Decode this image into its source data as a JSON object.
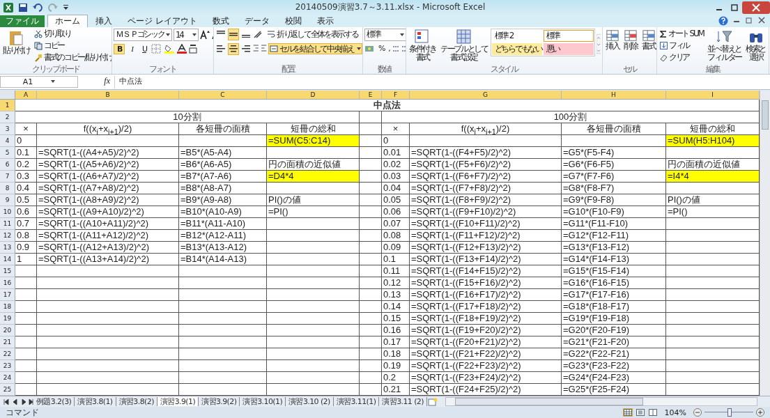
{
  "window": {
    "title": "20140509演習3.7～3.11.xlsx - Microsoft Excel"
  },
  "ribbon_tabs": [
    {
      "label": "ファイル",
      "kind": "file",
      "selected": false
    },
    {
      "label": "ホーム",
      "kind": "tab",
      "selected": true
    },
    {
      "label": "挿入",
      "kind": "tab",
      "selected": false
    },
    {
      "label": "ページ レイアウト",
      "kind": "tab",
      "selected": false
    },
    {
      "label": "数式",
      "kind": "tab",
      "selected": false
    },
    {
      "label": "データ",
      "kind": "tab",
      "selected": false
    },
    {
      "label": "校閲",
      "kind": "tab",
      "selected": false
    },
    {
      "label": "表示",
      "kind": "tab",
      "selected": false
    }
  ],
  "clipboard": {
    "paste": "貼り付け",
    "cut": "切り取り",
    "copy": "コピー",
    "format_painter": "書式のコピー/貼り付け",
    "label": "クリップボード"
  },
  "font": {
    "name": "ＭＳ Ｐゴシック",
    "size": "14",
    "label": "フォント",
    "format_buttons": [
      {
        "label": "B",
        "kind": "bold",
        "selected": true
      },
      {
        "label": "I",
        "kind": "italic",
        "selected": false
      },
      {
        "label": "U",
        "kind": "underline",
        "selected": false
      }
    ]
  },
  "alignment": {
    "top_buttons": [
      {
        "selected": false
      },
      {
        "selected": true
      },
      {
        "selected": false
      }
    ],
    "bottom_buttons": [
      {
        "selected": false
      },
      {
        "selected": true
      },
      {
        "selected": false
      }
    ],
    "wrap_text": "折り返して全体を表示する",
    "merge_center": "セルを結合して中央揃え",
    "merge_selected": true,
    "label": "配置"
  },
  "number": {
    "format": "標準",
    "percent": "%",
    "comma": ",",
    "label": "数値"
  },
  "styles": {
    "conditional": [
      "条件付き",
      "書式"
    ],
    "table": [
      "テーブルとして",
      "書式設定"
    ],
    "cells": [
      {
        "label": "標準 2",
        "color": "#ffffff",
        "selected": false
      },
      {
        "label": "標準",
        "color": "#ffffff",
        "selected": true
      },
      {
        "label": "どちらでもない",
        "color": "#ffeb9c",
        "selected": false
      },
      {
        "label": "悪い",
        "color": "#ffc7ce",
        "selected": false
      }
    ],
    "label": "スタイル"
  },
  "cells_group": {
    "buttons": [
      "挿入",
      "削除",
      "書式"
    ],
    "label": "セル"
  },
  "editing": {
    "autosum": "オート SUM",
    "fill": "フィル",
    "clear": "クリア",
    "sort": [
      "並べ替えと",
      "フィルター"
    ],
    "find": [
      "検索と",
      "選択"
    ],
    "label": "編集"
  },
  "formula_bar": {
    "name_box": "A1",
    "fx": "fx",
    "formula": "中点法"
  },
  "sheet": {
    "columns": [
      {
        "label": "A",
        "selected": true
      },
      {
        "label": "B",
        "selected": true
      },
      {
        "label": "C",
        "selected": true
      },
      {
        "label": "D",
        "selected": true
      },
      {
        "label": "E",
        "selected": true
      },
      {
        "label": "F",
        "selected": true
      },
      {
        "label": "G",
        "selected": true
      },
      {
        "label": "H",
        "selected": true
      },
      {
        "label": "I",
        "selected": true
      }
    ],
    "title_row": {
      "row": "1",
      "text": "中点法",
      "selected": true
    },
    "section_row": {
      "row": "2",
      "left": "10分割",
      "right": "100分割",
      "selected": false
    },
    "rows": [
      {
        "row": "3",
        "kind": "header",
        "selected": false,
        "A": "×",
        "B": "f((x$_{i}$+x$_{i+1}$)/2)",
        "C": "各短冊の面積",
        "D": "短冊の総和",
        "F": "×",
        "G": "f((x$_{i}$+x$_{i+1}$)/2)",
        "H": "各短冊の面積",
        "I": "短冊の総和"
      },
      {
        "row": "4",
        "kind": "data",
        "selected": false,
        "A": "0",
        "D": "=SUM(C5:C14)",
        "F": "0",
        "I": "=SUM(H5:H104)",
        "highlight": [
          false,
          false,
          false,
          true,
          false,
          false,
          false,
          false,
          true
        ]
      },
      {
        "row": "5",
        "kind": "data",
        "selected": false,
        "A": "0.1",
        "B": "=SQRT(1-((A4+A5)/2)^2)",
        "C": "=B5*(A5-A4)",
        "F": "0.01",
        "G": "=SQRT(1-((F4+F5)/2)^2)",
        "H": "=G5*(F5-F4)"
      },
      {
        "row": "6",
        "kind": "data",
        "selected": false,
        "A": "0.2",
        "B": "=SQRT(1-((A5+A6)/2)^2)",
        "C": "=B6*(A6-A5)",
        "D": "円の面積の近似値",
        "F": "0.02",
        "G": "=SQRT(1-((F5+F6)/2)^2)",
        "H": "=G6*(F6-F5)",
        "I": "円の面積の近似値"
      },
      {
        "row": "7",
        "kind": "data",
        "selected": false,
        "A": "0.3",
        "B": "=SQRT(1-((A6+A7)/2)^2)",
        "C": "=B7*(A7-A6)",
        "D": "=D4*4",
        "F": "0.03",
        "G": "=SQRT(1-((F6+F7)/2)^2)",
        "H": "=G7*(F7-F6)",
        "I": "=I4*4",
        "highlight": [
          false,
          false,
          false,
          true,
          false,
          false,
          false,
          false,
          true
        ]
      },
      {
        "row": "8",
        "kind": "data",
        "selected": false,
        "A": "0.4",
        "B": "=SQRT(1-((A7+A8)/2)^2)",
        "C": "=B8*(A8-A7)",
        "F": "0.04",
        "G": "=SQRT(1-((F7+F8)/2)^2)",
        "H": "=G8*(F8-F7)"
      },
      {
        "row": "9",
        "kind": "data",
        "selected": false,
        "A": "0.5",
        "B": "=SQRT(1-((A8+A9)/2)^2)",
        "C": "=B9*(A9-A8)",
        "D": "PI()の値",
        "F": "0.05",
        "G": "=SQRT(1-((F8+F9)/2)^2)",
        "H": "=G9*(F9-F8)",
        "I": "PI()の値"
      },
      {
        "row": "10",
        "kind": "data",
        "selected": false,
        "A": "0.6",
        "B": "=SQRT(1-((A9+A10)/2)^2)",
        "C": "=B10*(A10-A9)",
        "D": "=PI()",
        "F": "0.06",
        "G": "=SQRT(1-((F9+F10)/2)^2)",
        "H": "=G10*(F10-F9)",
        "I": "=PI()"
      },
      {
        "row": "11",
        "kind": "data",
        "selected": false,
        "A": "0.7",
        "B": "=SQRT(1-((A10+A11)/2)^2)",
        "C": "=B11*(A11-A10)",
        "F": "0.07",
        "G": "=SQRT(1-((F10+F11)/2)^2)",
        "H": "=G11*(F11-F10)"
      },
      {
        "row": "12",
        "kind": "data",
        "selected": false,
        "A": "0.8",
        "B": "=SQRT(1-((A11+A12)/2)^2)",
        "C": "=B12*(A12-A11)",
        "F": "0.08",
        "G": "=SQRT(1-((F11+F12)/2)^2)",
        "H": "=G12*(F12-F11)"
      },
      {
        "row": "13",
        "kind": "data",
        "selected": false,
        "A": "0.9",
        "B": "=SQRT(1-((A12+A13)/2)^2)",
        "C": "=B13*(A13-A12)",
        "F": "0.09",
        "G": "=SQRT(1-((F12+F13)/2)^2)",
        "H": "=G13*(F13-F12)"
      },
      {
        "row": "14",
        "kind": "data",
        "selected": false,
        "A": "1",
        "B": "=SQRT(1-((A13+A14)/2)^2)",
        "C": "=B14*(A14-A13)",
        "F": "0.1",
        "G": "=SQRT(1-((F13+F14)/2)^2)",
        "H": "=G14*(F14-F13)"
      },
      {
        "row": "15",
        "kind": "data",
        "selected": false,
        "F": "0.11",
        "G": "=SQRT(1-((F14+F15)/2)^2)",
        "H": "=G15*(F15-F14)"
      },
      {
        "row": "16",
        "kind": "data",
        "selected": false,
        "F": "0.12",
        "G": "=SQRT(1-((F15+F16)/2)^2)",
        "H": "=G16*(F16-F15)"
      },
      {
        "row": "17",
        "kind": "data",
        "selected": false,
        "F": "0.13",
        "G": "=SQRT(1-((F16+F17)/2)^2)",
        "H": "=G17*(F17-F16)"
      },
      {
        "row": "18",
        "kind": "data",
        "selected": false,
        "F": "0.14",
        "G": "=SQRT(1-((F17+F18)/2)^2)",
        "H": "=G18*(F18-F17)"
      },
      {
        "row": "19",
        "kind": "data",
        "selected": false,
        "F": "0.15",
        "G": "=SQRT(1-((F18+F19)/2)^2)",
        "H": "=G19*(F19-F18)"
      },
      {
        "row": "20",
        "kind": "data",
        "selected": false,
        "F": "0.16",
        "G": "=SQRT(1-((F19+F20)/2)^2)",
        "H": "=G20*(F20-F19)"
      },
      {
        "row": "21",
        "kind": "data",
        "selected": false,
        "F": "0.17",
        "G": "=SQRT(1-((F20+F21)/2)^2)",
        "H": "=G21*(F21-F20)"
      },
      {
        "row": "22",
        "kind": "data",
        "selected": false,
        "F": "0.18",
        "G": "=SQRT(1-((F21+F22)/2)^2)",
        "H": "=G22*(F22-F21)"
      },
      {
        "row": "23",
        "kind": "data",
        "selected": false,
        "F": "0.19",
        "G": "=SQRT(1-((F22+F23)/2)^2)",
        "H": "=G23*(F23-F22)"
      },
      {
        "row": "24",
        "kind": "data",
        "selected": false,
        "F": "0.2",
        "G": "=SQRT(1-((F23+F24)/2)^2)",
        "H": "=G24*(F24-F23)"
      },
      {
        "row": "25",
        "kind": "data",
        "selected": false,
        "F": "0.21",
        "G": "=SQRT(1-((F24+F25)/2)^2)",
        "H": "=G25*(F25-F24)"
      }
    ]
  },
  "sheet_tabs": [
    {
      "label": "例題3.2(3)",
      "selected": false
    },
    {
      "label": "演習3.8(1)",
      "selected": false
    },
    {
      "label": "演習3.8(2)",
      "selected": false
    },
    {
      "label": "演習3.9(1)",
      "selected": true
    },
    {
      "label": "演習3.9(2)",
      "selected": false
    },
    {
      "label": "演習3.10(1)",
      "selected": false
    },
    {
      "label": "演習3.10 (2)",
      "selected": false
    },
    {
      "label": "演習3.11(1)",
      "selected": false
    },
    {
      "label": "演習3.11 (2)",
      "selected": false
    }
  ],
  "status_bar": {
    "mode": "コマンド",
    "views": [
      {
        "kind": "normal",
        "selected": true
      },
      {
        "kind": "layout",
        "selected": false
      },
      {
        "kind": "pagebreak",
        "selected": false
      }
    ],
    "zoom": "104%",
    "zoom_slider": {
      "level": 0.52
    }
  }
}
